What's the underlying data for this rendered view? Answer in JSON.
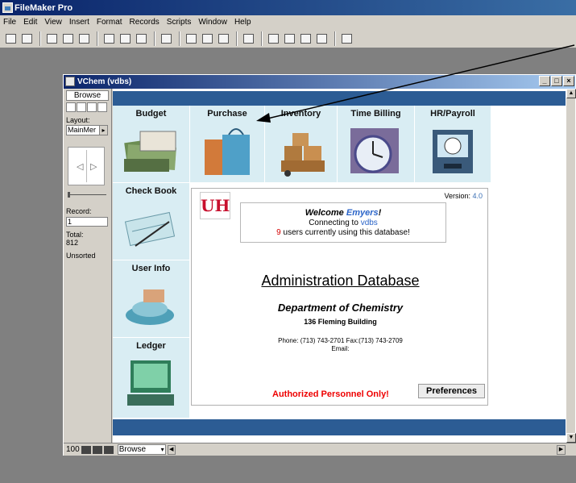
{
  "app": {
    "title": "FileMaker Pro"
  },
  "menubar": {
    "items": [
      "File",
      "Edit",
      "View",
      "Insert",
      "Format",
      "Records",
      "Scripts",
      "Window",
      "Help"
    ]
  },
  "window": {
    "title": "VChem (vdbs)",
    "controls": [
      "_",
      "□",
      "×"
    ]
  },
  "sidebar": {
    "mode": "Browse",
    "layout_label": "Layout:",
    "layout_value": "MainMer",
    "record_label": "Record:",
    "record_value": "1",
    "total_label": "Total:",
    "total_value": "812",
    "sort_status": "Unsorted"
  },
  "nav": {
    "budget": "Budget",
    "purchase": "Purchase",
    "inventory": "Inventory",
    "time_billing": "Time Billing",
    "hr_payroll": "HR/Payroll",
    "check_book": "Check Book",
    "user_info": "User Info",
    "ledger": "Ledger"
  },
  "content": {
    "logo_text": "UH",
    "version_label": "Version:",
    "version_value": "4.0",
    "welcome_prefix": "Welcome",
    "welcome_name": "Emyers",
    "welcome_suffix": "!",
    "connecting_prefix": "Connecting to",
    "database_name": "vdbs",
    "user_count": "9",
    "users_suffix": "users currently using this database!",
    "main_title": "Administration Database",
    "department": "Department of Chemistry",
    "building": "136 Fleming Building",
    "phone": "Phone: (713) 743-2701 Fax:(713) 743-2709",
    "email": "Email:",
    "authorized": "Authorized Personnel Only!",
    "preferences": "Preferences"
  },
  "bottombar": {
    "zoom": "100",
    "mode": "Browse"
  },
  "colors": {
    "band": "#2c5c94",
    "tile": "#d9edf3",
    "accent_red": "#e00000",
    "link_blue": "#2a64c8"
  }
}
